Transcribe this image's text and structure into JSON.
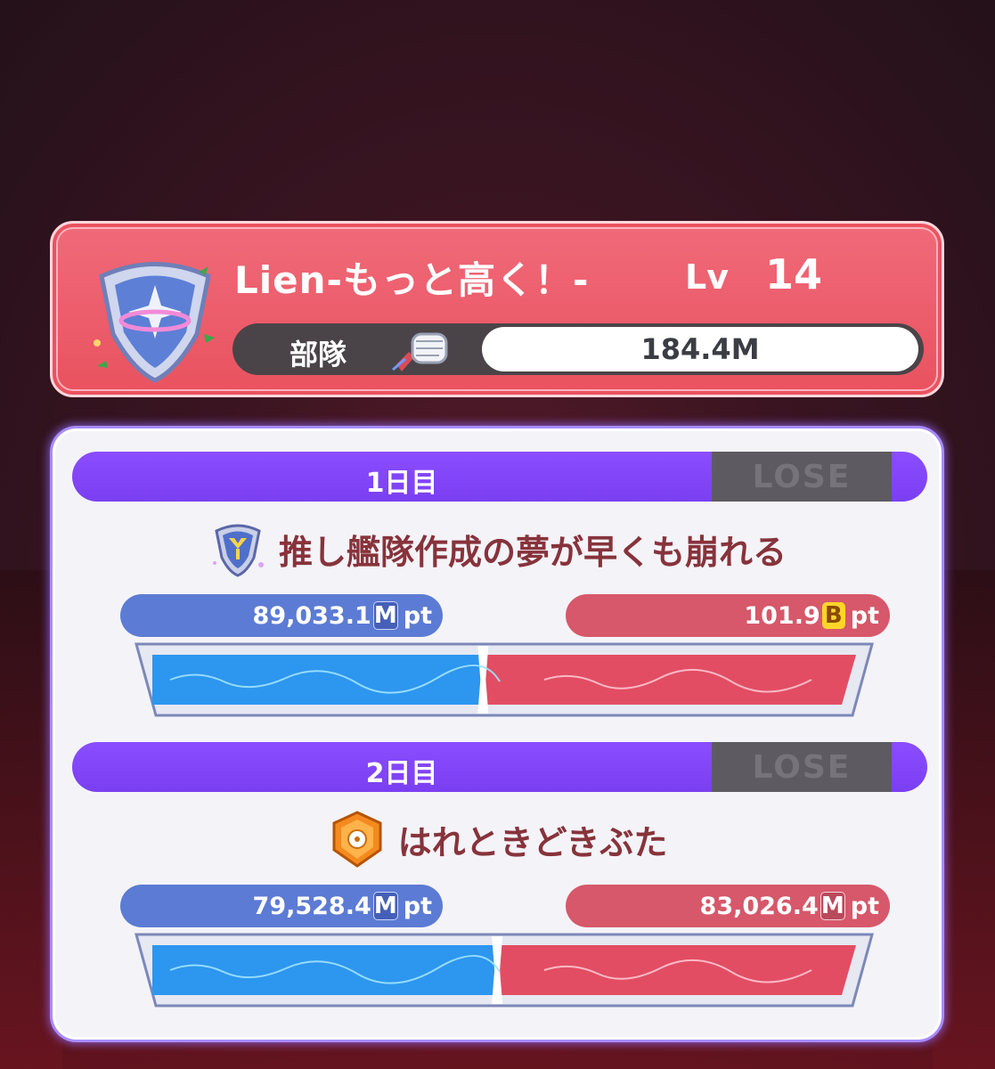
{
  "team": {
    "name": "Lien-もっと高く！-",
    "level_label": "Lv",
    "level": "14",
    "power_label": "部隊",
    "power_value": "184.4M"
  },
  "days": [
    {
      "label": "1日目",
      "result": "LOSE",
      "opponent_name": "推し艦隊作成の夢が早くも崩れる",
      "opponent_icon": "shield-emblem-icon",
      "my_score": "89,033.1",
      "my_unit": "M",
      "opp_score": "101.9",
      "opp_unit": "B",
      "pt": "pt",
      "my_share": 0.47
    },
    {
      "label": "2日目",
      "result": "LOSE",
      "opponent_name": "はれときどきぶた",
      "opponent_icon": "orange-badge-icon",
      "my_score": "79,528.4",
      "my_unit": "M",
      "opp_score": "83,026.4",
      "opp_unit": "M",
      "pt": "pt",
      "my_share": 0.49
    }
  ],
  "colors": {
    "header_bg": "#e9525f",
    "day_bar": "#7b3ff2",
    "my_side": "#5c7bd4",
    "opp_side": "#d6586a",
    "lose_badge": "#5e5a61"
  }
}
